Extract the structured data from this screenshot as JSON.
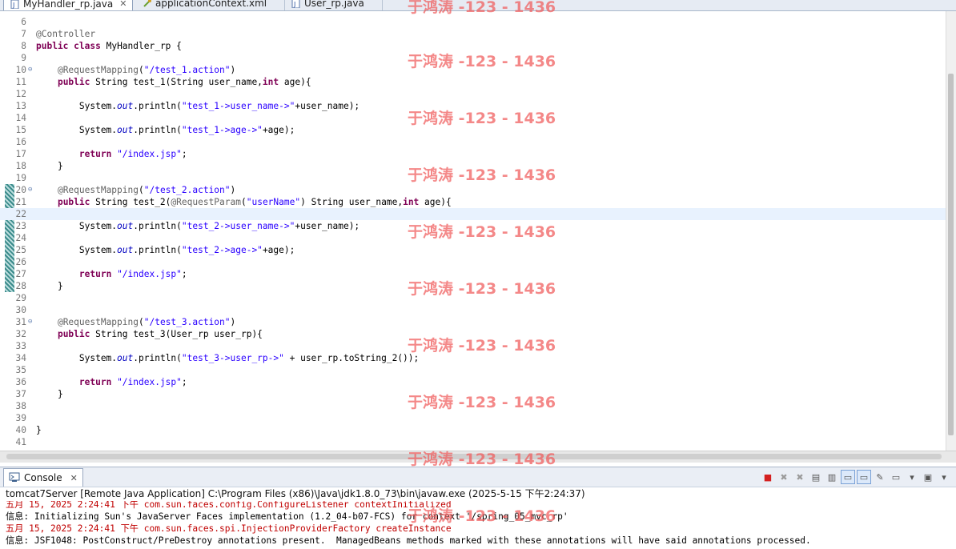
{
  "tabs": [
    {
      "label": "MyHandler_rp.java",
      "icon": "java-file-icon",
      "active": true,
      "close": "✕"
    },
    {
      "label": "applicationContext.xml",
      "icon": "xml-file-icon",
      "active": false
    },
    {
      "label": "User_rp.java",
      "icon": "java-file-icon",
      "active": false
    }
  ],
  "editor": {
    "lines": [
      {
        "n": "6",
        "html": ""
      },
      {
        "n": "7",
        "html": "<span class='ann'>@Controller</span>"
      },
      {
        "n": "8",
        "html": "<span class='kw'>public</span> <span class='kw'>class</span> MyHandler_rp {"
      },
      {
        "n": "9",
        "html": ""
      },
      {
        "n": "10",
        "fold": "⊖",
        "html": "    <span class='ann'>@RequestMapping</span>(<span class='str'>\"/test_1.action\"</span>)"
      },
      {
        "n": "11",
        "html": "    <span class='kw'>public</span> String test_1(String user_name,<span class='kw'>int</span> age){"
      },
      {
        "n": "12",
        "html": ""
      },
      {
        "n": "13",
        "html": "        System.<span class='fld'>out</span>.println(<span class='str'>\"test_1->user_name->\"</span>+user_name);"
      },
      {
        "n": "14",
        "html": ""
      },
      {
        "n": "15",
        "html": "        System.<span class='fld'>out</span>.println(<span class='str'>\"test_1->age->\"</span>+age);"
      },
      {
        "n": "16",
        "html": ""
      },
      {
        "n": "17",
        "html": "        <span class='kw'>return</span> <span class='str'>\"/index.jsp\"</span>;"
      },
      {
        "n": "18",
        "html": "    }"
      },
      {
        "n": "19",
        "html": ""
      },
      {
        "n": "20",
        "fold": "⊖",
        "html": "    <span class='ann'>@RequestMapping</span>(<span class='str'>\"/test_2.action\"</span>)"
      },
      {
        "n": "21",
        "html": "    <span class='kw'>public</span> String test_2(<span class='ann'>@RequestParam</span>(<span class='str'>\"userName\"</span>) String user_name,<span class='kw'>int</span> age){"
      },
      {
        "n": "22",
        "html": "",
        "current": true
      },
      {
        "n": "23",
        "html": "        System.<span class='fld'>out</span>.println(<span class='str'>\"test_2->user_name->\"</span>+user_name);"
      },
      {
        "n": "24",
        "html": ""
      },
      {
        "n": "25",
        "html": "        System.<span class='fld'>out</span>.println(<span class='str'>\"test_2->age->\"</span>+age);"
      },
      {
        "n": "26",
        "html": ""
      },
      {
        "n": "27",
        "html": "        <span class='kw'>return</span> <span class='str'>\"/index.jsp\"</span>;"
      },
      {
        "n": "28",
        "html": "    }"
      },
      {
        "n": "29",
        "html": ""
      },
      {
        "n": "30",
        "html": ""
      },
      {
        "n": "31",
        "fold": "⊖",
        "html": "    <span class='ann'>@RequestMapping</span>(<span class='str'>\"/test_3.action\"</span>)"
      },
      {
        "n": "32",
        "html": "    <span class='kw'>public</span> String test_3(User_rp user_rp){"
      },
      {
        "n": "33",
        "html": ""
      },
      {
        "n": "34",
        "html": "        System.<span class='fld'>out</span>.println(<span class='str'>\"test_3->user_rp->\"</span> + user_rp.toString_2());"
      },
      {
        "n": "35",
        "html": ""
      },
      {
        "n": "36",
        "html": "        <span class='kw'>return</span> <span class='str'>\"/index.jsp\"</span>;"
      },
      {
        "n": "37",
        "html": "    }"
      },
      {
        "n": "38",
        "html": ""
      },
      {
        "n": "39",
        "html": ""
      },
      {
        "n": "40",
        "html": "}"
      },
      {
        "n": "41",
        "html": ""
      }
    ]
  },
  "console": {
    "tab_label": "Console",
    "tab_close": "✕",
    "description": "tomcat7Server [Remote Java Application] C:\\Program Files (x86)\\Java\\jdk1.8.0_73\\bin\\javaw.exe (2025-5-15 下午2:24:37)",
    "output": [
      {
        "text": "五月 15, 2025 2:24:41 下午 com.sun.faces.config.ConfigureListener contextInitialized",
        "red": true
      },
      {
        "text": "信息: Initializing Sun's JavaServer Faces implementation (1.2_04-b07-FCS) for context '/spring_05_mvc_rp'",
        "red": false
      },
      {
        "text": "五月 15, 2025 2:24:41 下午 com.sun.faces.spi.InjectionProviderFactory createInstance",
        "red": true
      },
      {
        "text": "信息: JSF1048: PostConstruct/PreDestroy annotations present.  ManagedBeans methods marked with these annotations will have said annotations processed.",
        "red": false
      }
    ],
    "toolbar": [
      {
        "icon": "terminate-icon",
        "glyph": "■"
      },
      {
        "icon": "remove-launch-icon",
        "glyph": "✖"
      },
      {
        "icon": "remove-all-terminated-icon",
        "glyph": "✖"
      },
      {
        "icon": "clear-console-icon",
        "glyph": "▤"
      },
      {
        "icon": "scroll-lock-icon",
        "glyph": "▥"
      },
      {
        "icon": "show-on-stdout-icon",
        "glyph": "▭"
      },
      {
        "icon": "show-on-stderr-icon",
        "glyph": "▭"
      },
      {
        "icon": "pin-console-icon",
        "glyph": "✎"
      },
      {
        "icon": "display-selected-console-icon",
        "glyph": "▭"
      },
      {
        "icon": "dropdown-icon",
        "glyph": "▾"
      },
      {
        "icon": "open-console-icon",
        "glyph": "▣"
      },
      {
        "icon": "view-menu-icon",
        "glyph": "▾"
      }
    ]
  },
  "watermark": "于鸿涛 -123 - 1436",
  "colors": {
    "keyword": "#7f0055",
    "string": "#2a00ff",
    "annotation": "#646464",
    "field": "#0000c0",
    "current_line": "#e8f2fe",
    "watermark": "#f05a5a",
    "terminate": "#d42020"
  }
}
